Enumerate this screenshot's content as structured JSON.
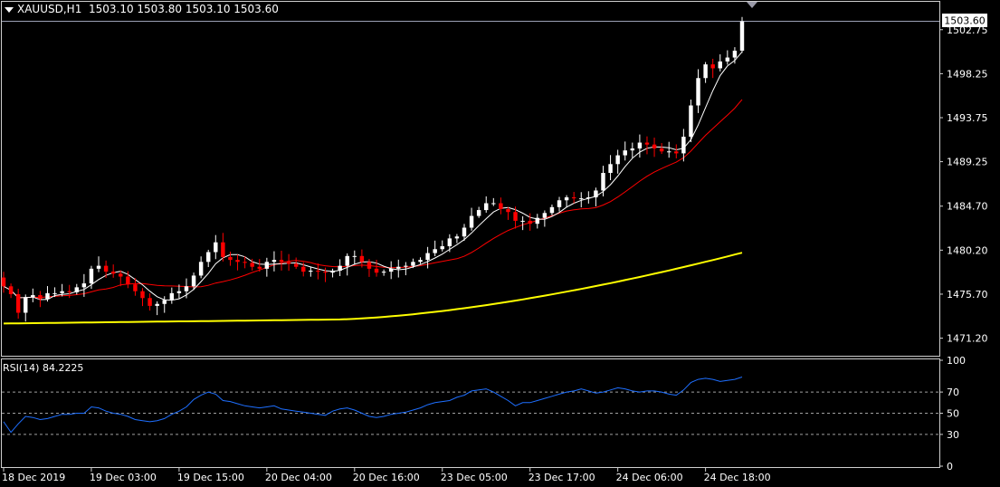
{
  "header": {
    "symbol_tf": "XAUUSD,H1",
    "ohlc": "1503.10 1503.80 1503.10 1503.60"
  },
  "price_tag": "1503.60",
  "colors": {
    "background": "#000000",
    "bull_candle": "#ffffff",
    "bear_candle": "#ff0000",
    "ma_fast": "#ffffff",
    "ma_mid": "#ff0000",
    "ma_slow": "#ffff00",
    "rsi_line": "#1e6fff",
    "grid_dash": "#a0a0a0",
    "frame": "#d0d0d0"
  },
  "chart_data": [
    {
      "type": "candlestick",
      "ylim": [
        1469.4,
        1505.6
      ],
      "ytick_labels": [
        "1502.75",
        "1498.25",
        "1493.75",
        "1489.25",
        "1484.70",
        "1480.20",
        "1475.70",
        "1471.20"
      ],
      "ytick_values": [
        1502.75,
        1498.25,
        1493.75,
        1489.25,
        1484.7,
        1480.2,
        1475.7,
        1471.2
      ],
      "xtick_labels": [
        "18 Dec 2019",
        "19 Dec 03:00",
        "19 Dec 15:00",
        "20 Dec 04:00",
        "20 Dec 16:00",
        "23 Dec 05:00",
        "23 Dec 17:00",
        "24 Dec 06:00",
        "24 Dec 18:00"
      ],
      "xtick_index": [
        0,
        12,
        24,
        36,
        48,
        60,
        72,
        84,
        96
      ],
      "candles_close": [
        1476.5,
        1475.7,
        1473.8,
        1475.4,
        1475.6,
        1475.2,
        1475.8,
        1475.8,
        1476.0,
        1475.9,
        1476.4,
        1476.8,
        1478.3,
        1478.6,
        1478.0,
        1477.8,
        1477.5,
        1476.7,
        1476.0,
        1475.3,
        1474.5,
        1474.7,
        1475.1,
        1475.8,
        1476.0,
        1476.5,
        1477.6,
        1479.0,
        1480.0,
        1481.0,
        1479.5,
        1479.2,
        1479.0,
        1478.9,
        1478.5,
        1478.3,
        1479.0,
        1479.2,
        1479.0,
        1478.8,
        1478.5,
        1478.0,
        1478.1,
        1478.0,
        1477.9,
        1478.1,
        1478.6,
        1479.6,
        1479.6,
        1479.0,
        1478.3,
        1477.9,
        1478.0,
        1478.3,
        1478.5,
        1478.6,
        1479.0,
        1479.2,
        1479.9,
        1480.3,
        1480.6,
        1481.4,
        1481.6,
        1482.5,
        1483.7,
        1484.3,
        1485.0,
        1485.0,
        1484.4,
        1484.1,
        1483.2,
        1483.2,
        1482.9,
        1483.5,
        1484.0,
        1484.6,
        1485.3,
        1485.6,
        1485.5,
        1485.5,
        1485.6,
        1486.3,
        1488.1,
        1489.0,
        1489.9,
        1490.4,
        1490.6,
        1491.2,
        1491.0,
        1490.6,
        1490.3,
        1490.3,
        1490.1,
        1491.8,
        1495.0,
        1497.8,
        1499.2,
        1498.8,
        1499.5,
        1499.9,
        1500.6,
        1503.6
      ],
      "ma_fast_label": "",
      "rsi": {
        "title": "RSI(14) 84.2225",
        "ylim": [
          0,
          100
        ],
        "levels": [
          30,
          50,
          70
        ],
        "ytick_labels": [
          "100",
          "70",
          "50",
          "30",
          "0"
        ],
        "ytick_values": [
          100,
          70,
          50,
          30,
          0
        ],
        "values": [
          42,
          32,
          40,
          47,
          46,
          44,
          45,
          47,
          49,
          49,
          50,
          50,
          56,
          55,
          52,
          50,
          49,
          47,
          44,
          43,
          42,
          43,
          45,
          49,
          52,
          56,
          63,
          67,
          70,
          68,
          62,
          61,
          59,
          57,
          56,
          55,
          56,
          57,
          54,
          53,
          52,
          51,
          50,
          49,
          48,
          52,
          54,
          55,
          53,
          50,
          47,
          46,
          47,
          49,
          50,
          51,
          53,
          55,
          58,
          60,
          61,
          62,
          65,
          67,
          71,
          72,
          73,
          70,
          66,
          62,
          57,
          60,
          60,
          62,
          64,
          66,
          68,
          70,
          71,
          73,
          71,
          69,
          70,
          72,
          74,
          73,
          71,
          70,
          71,
          71,
          70,
          68,
          67,
          72,
          79,
          82,
          83,
          82,
          80,
          81,
          82,
          84.2
        ]
      }
    }
  ]
}
